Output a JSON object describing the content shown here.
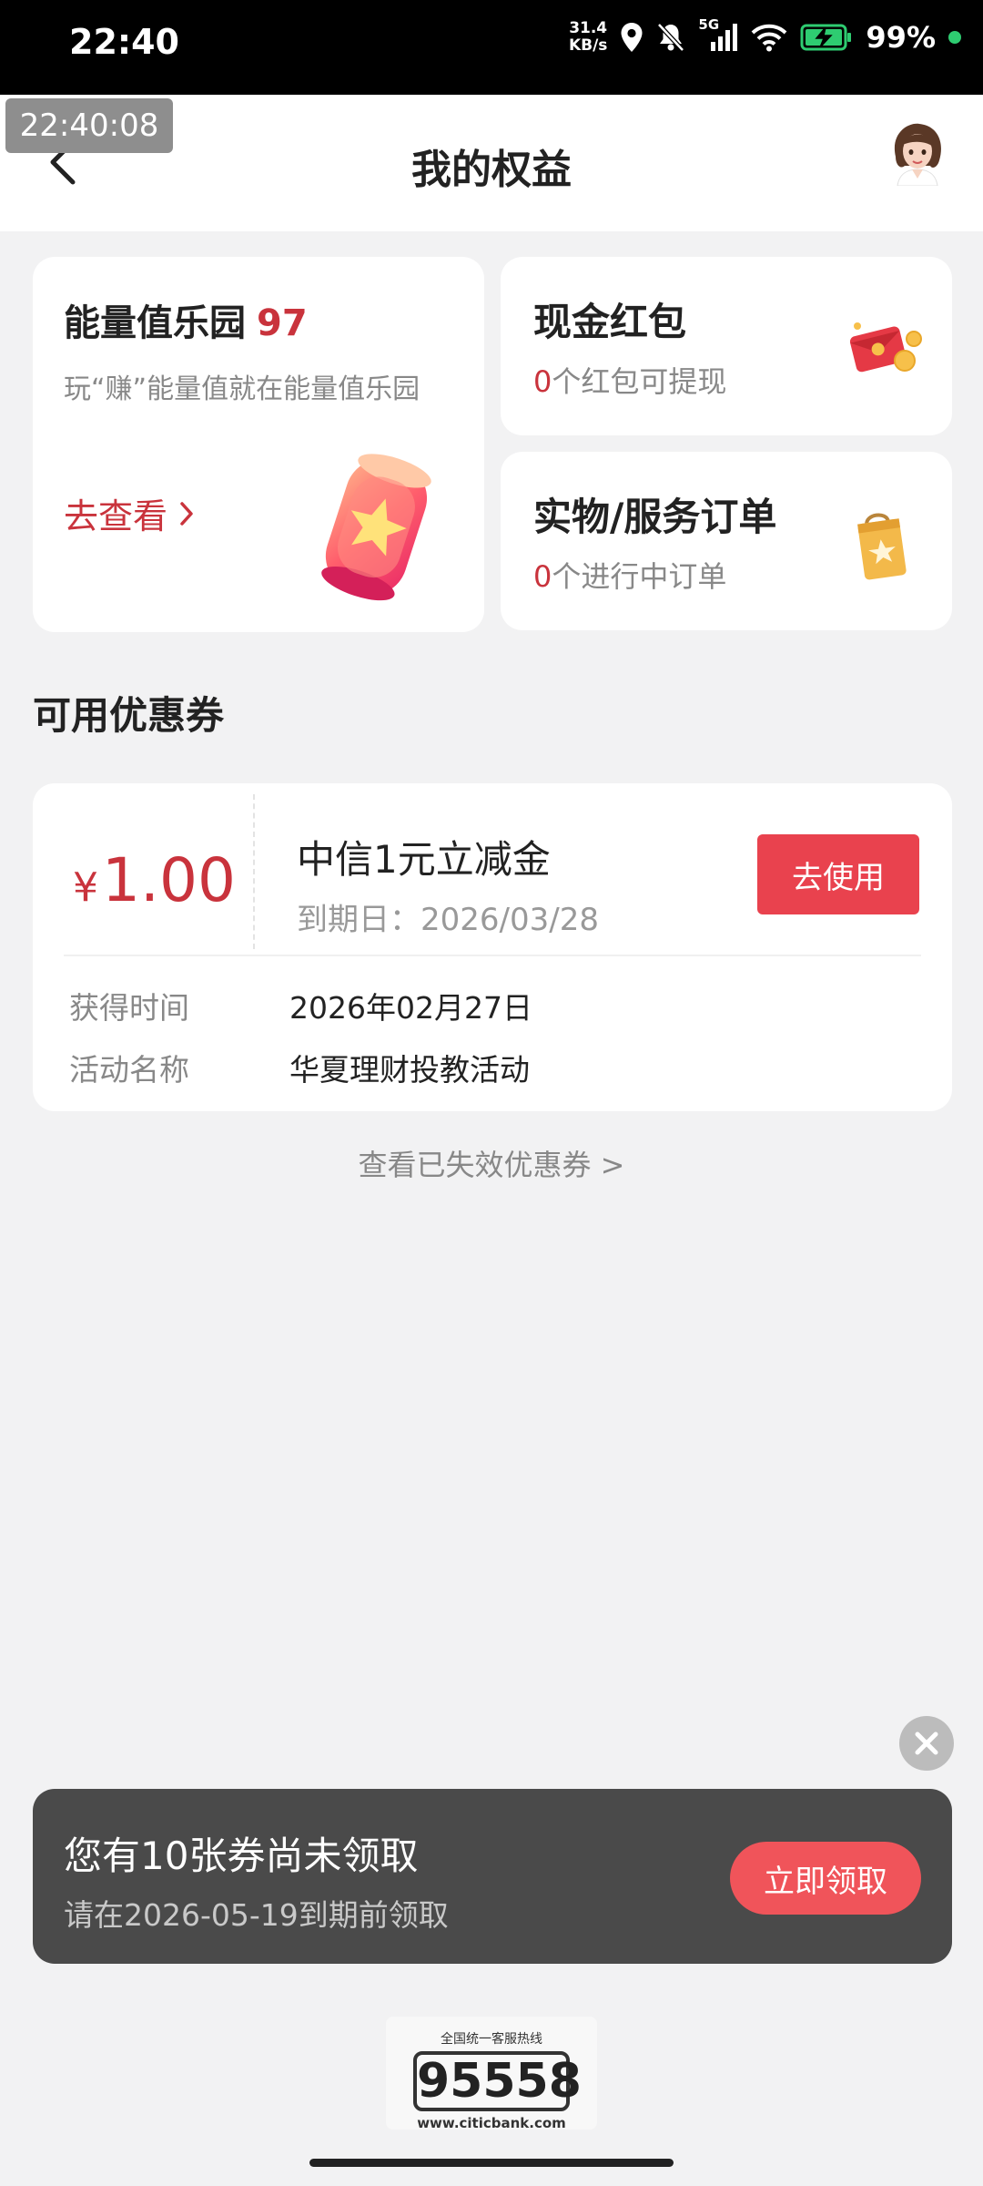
{
  "status_bar": {
    "time": "22:40",
    "net_speed_value": "31.4",
    "net_speed_unit": "KB/s",
    "network": "5G",
    "battery": "99%",
    "icons": [
      "location-icon",
      "mute-icon",
      "signal-icon",
      "wifi-icon",
      "battery-charging-icon"
    ]
  },
  "overlay_time": "22:40:08",
  "header": {
    "title": "我的权益",
    "back_icon": "chevron-left-icon",
    "avatar": "avatar"
  },
  "energy_card": {
    "title": "能量值乐园",
    "value": "97",
    "desc": "玩“赚”能量值就在能量值乐园",
    "link_label": "去查看",
    "link_icon": "chevron-right-icon",
    "illustration": "lantern-icon"
  },
  "cash_card": {
    "title": "现金红包",
    "count": "0",
    "sub": "个红包可提现",
    "icon": "red-envelope-icon"
  },
  "order_card": {
    "title": "实物/服务订单",
    "count": "0",
    "sub": "个进行中订单",
    "icon": "shopping-bag-icon"
  },
  "coupons_section": {
    "title": "可用优惠券",
    "items": [
      {
        "currency": "¥",
        "amount": "1.00",
        "name": "中信1元立减金",
        "expiry": "到期日：2026/03/28",
        "use_label": "去使用",
        "obtained_label": "获得时间",
        "obtained_value": "2026年02月27日",
        "activity_label": "活动名称",
        "activity_value": "华夏理财投教活动"
      }
    ],
    "expired_link": "查看已失效优惠券 >"
  },
  "banner": {
    "title": "您有10张券尚未领取",
    "sub": "请在2026-05-19到期前领取",
    "claim_label": "立即领取",
    "close_icon": "close-icon"
  },
  "hotline": {
    "caption": "全国统一客服热线",
    "number": "95558",
    "url": "www.citicbank.com"
  },
  "colors": {
    "accent": "#c9333c",
    "button_red": "#e9424e",
    "banner_bg": "#4a4a4a",
    "page_bg": "#f2f2f3"
  }
}
